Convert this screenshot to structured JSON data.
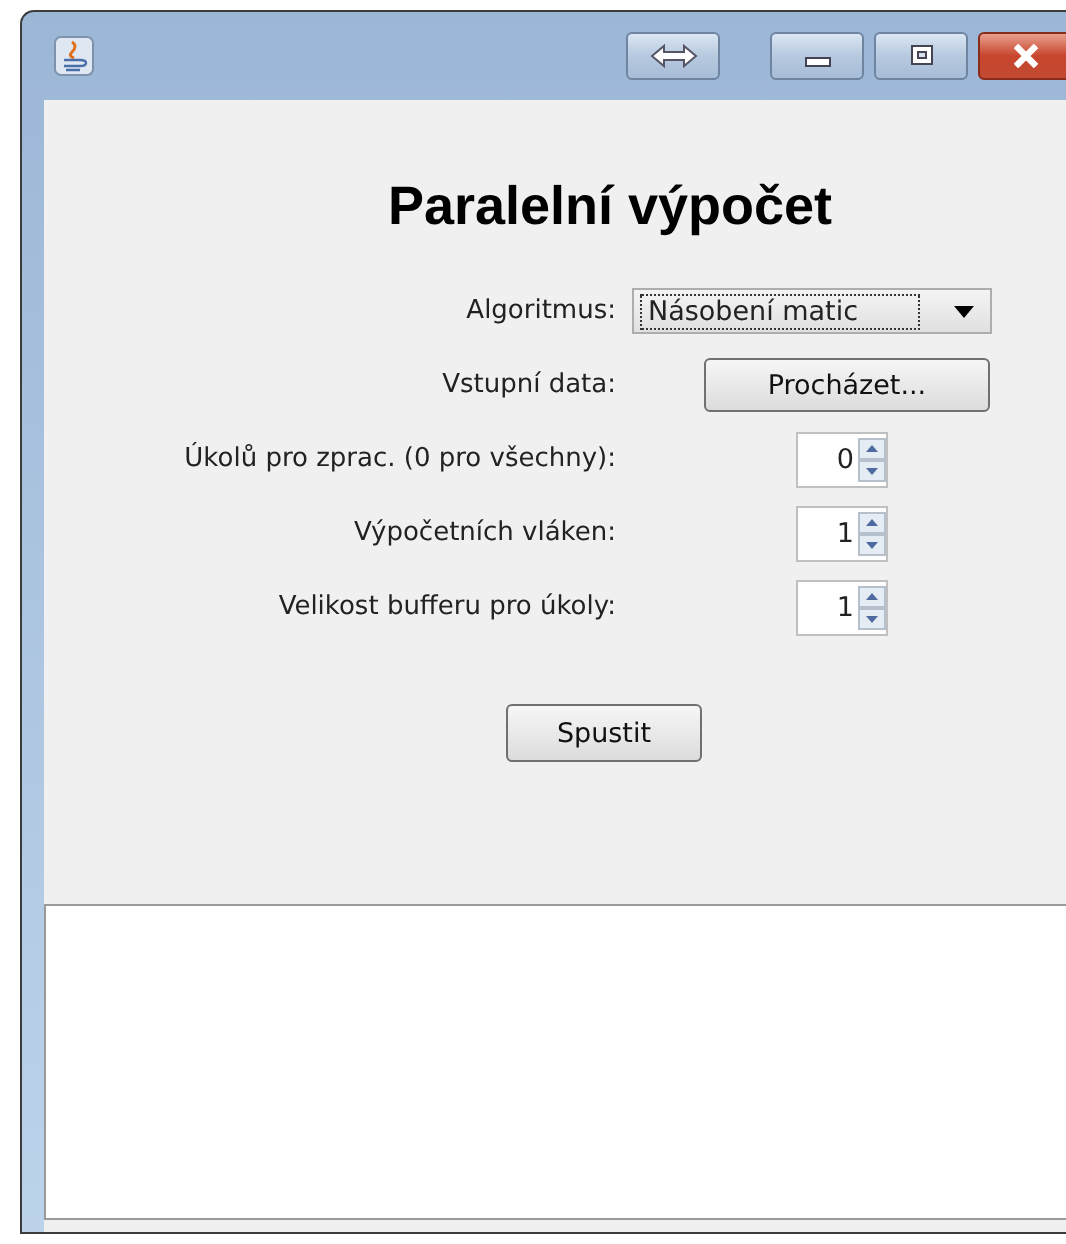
{
  "heading": "Paralelní výpočet",
  "fields": [
    {
      "kind": "combo",
      "label": "Algoritmus:",
      "value": "Násobení matic"
    },
    {
      "kind": "button",
      "label": "Vstupní data:",
      "value": "Procházet..."
    },
    {
      "kind": "spinner",
      "label": "Úkolů pro zprac. (0 pro všechny):",
      "value": "0"
    },
    {
      "kind": "spinner",
      "label": "Výpočetních vláken:",
      "value": "1"
    },
    {
      "kind": "spinner",
      "label": "Velikost bufferu pro úkoly:",
      "value": "1"
    }
  ],
  "run_button": "Spustit"
}
